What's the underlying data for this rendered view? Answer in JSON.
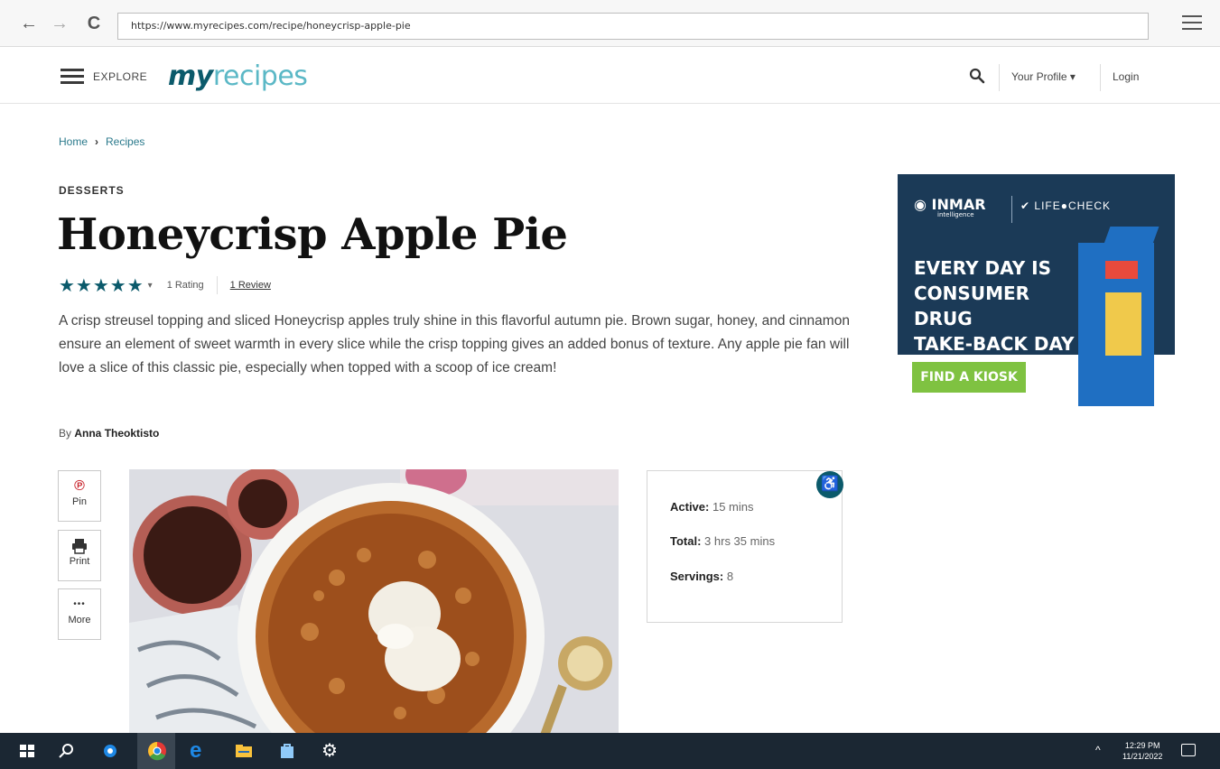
{
  "browser": {
    "url": "https://www.myrecipes.com/recipe/honeycrisp-apple-pie",
    "back_icon": "←",
    "forward_icon": "→",
    "reload_icon": "C"
  },
  "header": {
    "explore_label": "EXPLORE",
    "logo_my": "my",
    "logo_recipes": "recipes",
    "profile_label": "Your Profile ▾",
    "login_label": "Login"
  },
  "breadcrumb": {
    "home": "Home",
    "separator": "›",
    "recipes": "Recipes"
  },
  "recipe": {
    "category": "DESSERTS",
    "title": "Honeycrisp Apple Pie",
    "stars": "★★★★★",
    "rating_value": 5,
    "rating_count": "1 Rating",
    "reviews": "1 Review",
    "description": "A crisp streusel topping and sliced Honeycrisp apples truly shine in this flavorful autumn pie. Brown sugar, honey, and cinnamon ensure an element of sweet warmth in every slice while the crisp topping gives an added bonus of texture. Any apple pie fan will love a slice of this classic pie, especially when topped with a scoop of ice cream!",
    "by_label": "By",
    "author": "Anna Theoktisto"
  },
  "share": {
    "pin": "Pin",
    "print": "Print",
    "more": "More",
    "more_icon": "•••"
  },
  "info": {
    "active_label": "Active:",
    "active_value": "15 mins",
    "total_label": "Total:",
    "total_value": "3 hrs 35 mins",
    "servings_label": "Servings:",
    "servings_value": "8"
  },
  "ad": {
    "brand1": "INMAR",
    "brand1_sub": "intelligence",
    "brand2": "LIFE●CHECK",
    "headline_1": "EVERY DAY IS",
    "headline_2": "CONSUMER DRUG",
    "headline_3": "TAKE-BACK DAY",
    "cta": "FIND A KIOSK"
  },
  "taskbar": {
    "time": "12:29 PM",
    "date": "11/21/2022"
  },
  "colors": {
    "brand_teal": "#0b5a6b",
    "link_teal": "#2b7a8c",
    "ad_navy": "#1b3a57",
    "ad_green": "#7fc241"
  }
}
